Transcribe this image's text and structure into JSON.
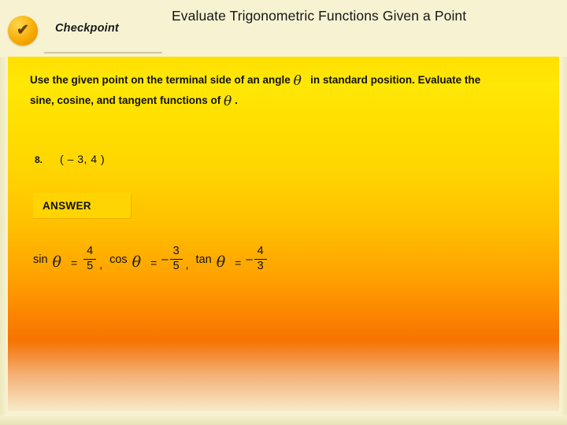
{
  "header": {
    "badge_icon": "check-icon",
    "badge_glyph": "✔",
    "checkpoint_label": "Checkpoint",
    "title": "Evaluate Trigonometric Functions Given a Point"
  },
  "instructions": {
    "part1": "Use the given point on the terminal side of an angle",
    "theta": "θ",
    "part2": "in standard position. Evaluate the sine, cosine, and tangent functions of",
    "part3": "."
  },
  "problem": {
    "number": "8.",
    "point": "( – 3, 4 )"
  },
  "answer": {
    "label": "ANSWER",
    "terms": [
      {
        "function": "sin",
        "theta": "θ",
        "equals": "=",
        "sign": "",
        "numerator": "4",
        "denominator": "5",
        "separator": ","
      },
      {
        "function": "cos",
        "theta": "θ",
        "equals": "=",
        "sign": "–",
        "numerator": "3",
        "denominator": "5",
        "separator": ","
      },
      {
        "function": "tan",
        "theta": "θ",
        "equals": "=",
        "sign": "–",
        "numerator": "4",
        "denominator": "3",
        "separator": ""
      }
    ]
  },
  "colors": {
    "background": "#f7f3d2",
    "gradient_top": "#ffe000",
    "gradient_bottom": "#ee5200",
    "answer_box": "#ffd400",
    "badge": "#f5a800"
  }
}
